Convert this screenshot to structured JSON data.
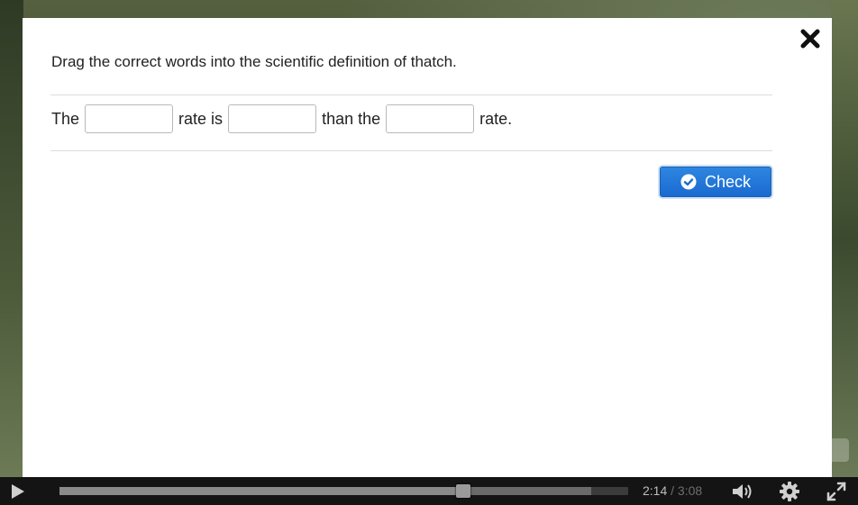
{
  "modal": {
    "instruction": "Drag the correct words into the scientific definition of thatch.",
    "sentence": {
      "word1": "The",
      "word2": "rate is",
      "word3": "than the",
      "word4": "rate."
    },
    "check_label": "Check",
    "icons": {
      "close": "close-icon",
      "check": "check-circle-icon"
    }
  },
  "player": {
    "current_time": "2:14",
    "separator": "/",
    "total_time": "3:08",
    "progress_played": 0.71,
    "progress_buffered": 0.935,
    "icons": [
      "play-icon",
      "volume-icon",
      "settings-gear-icon",
      "fullscreen-icon"
    ]
  },
  "colors": {
    "accent": "#1a6ad1",
    "overlay_bg": "#ffffff",
    "controls_bg": "#141414"
  }
}
